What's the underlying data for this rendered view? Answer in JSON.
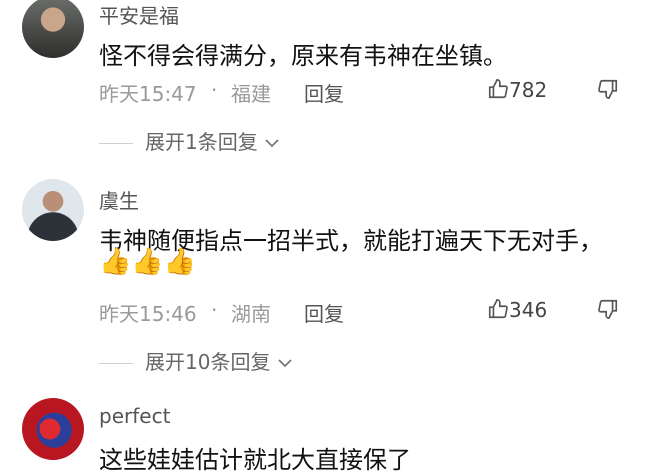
{
  "comments": [
    {
      "username": "平安是福",
      "content": "怪不得会得满分，原来有韦神在坐镇。",
      "time": "昨天15:47",
      "location": "福建",
      "reply_label": "回复",
      "likes": "782",
      "expand_label": "展开1条回复"
    },
    {
      "username": "虞生",
      "content": "韦神随便指点一招半式，就能打遍天下无对手，",
      "emoji": "👍👍👍",
      "time": "昨天15:46",
      "location": "湖南",
      "reply_label": "回复",
      "likes": "346",
      "expand_label": "展开10条回复"
    },
    {
      "username": "perfect",
      "content": "这些娃娃估计就北大直接保了"
    }
  ],
  "separator": "·",
  "icons": {
    "like": "thumbs-up-icon",
    "dislike": "thumbs-down-icon",
    "expand": "chevron-down-icon"
  }
}
